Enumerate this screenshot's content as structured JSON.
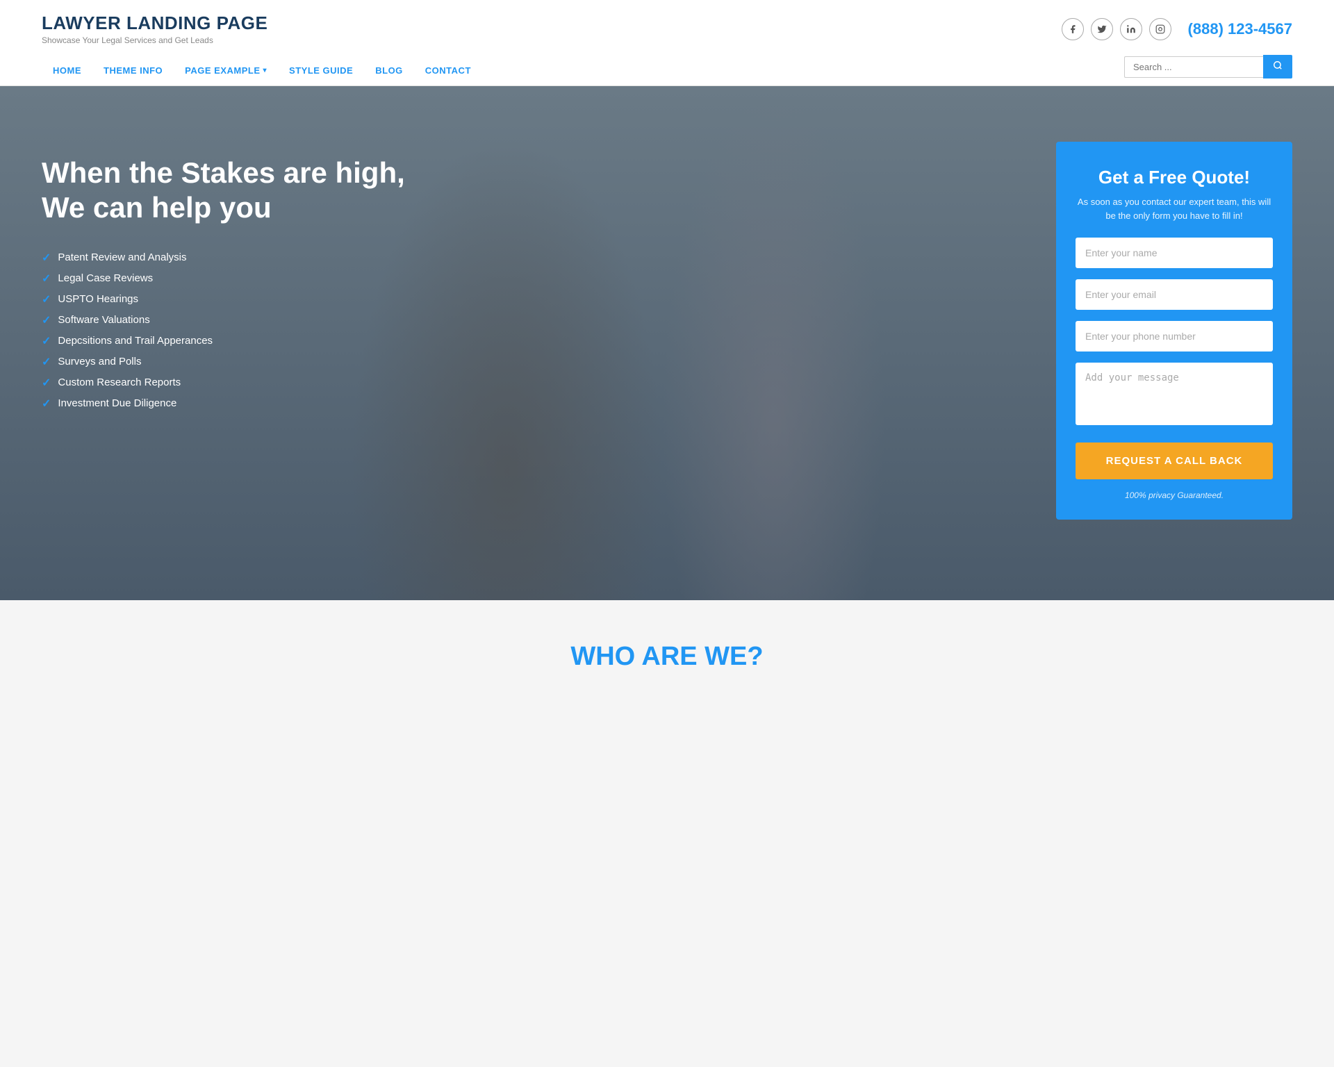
{
  "header": {
    "logo_title": "LAWYER LANDING PAGE",
    "logo_subtitle": "Showcase Your Legal Services and Get Leads",
    "phone": "(888) 123-4567",
    "social": [
      {
        "name": "facebook",
        "icon": "f"
      },
      {
        "name": "twitter",
        "icon": "t"
      },
      {
        "name": "linkedin",
        "icon": "in"
      },
      {
        "name": "instagram",
        "icon": "ig"
      }
    ],
    "nav": [
      {
        "label": "HOME",
        "has_dropdown": false
      },
      {
        "label": "THEME INFO",
        "has_dropdown": false
      },
      {
        "label": "PAGE EXAMPLE",
        "has_dropdown": true
      },
      {
        "label": "STYLE GUIDE",
        "has_dropdown": false
      },
      {
        "label": "BLOG",
        "has_dropdown": false
      },
      {
        "label": "CONTACT",
        "has_dropdown": false
      }
    ],
    "search_placeholder": "Search ..."
  },
  "hero": {
    "headline_line1": "When the Stakes are high,",
    "headline_line2": "We can help you",
    "checklist": [
      "Patent Review and Analysis",
      "Legal Case Reviews",
      "USPTO Hearings",
      "Software Valuations",
      "Depcsitions and Trail Apperances",
      "Surveys and Polls",
      "Custom Research Reports",
      "Investment Due Diligence"
    ]
  },
  "quote_form": {
    "title": "Get a Free Quote!",
    "subtitle": "As soon as you contact our expert team, this will be the only form you have to fill in!",
    "name_placeholder": "Enter your name",
    "email_placeholder": "Enter your email",
    "phone_placeholder": "Enter your phone number",
    "message_placeholder": "Add your message",
    "submit_label": "REQUEST A CALL BACK",
    "privacy_text": "100% privacy Guaranteed."
  },
  "below_hero": {
    "heading": "WHO ARE WE?"
  }
}
